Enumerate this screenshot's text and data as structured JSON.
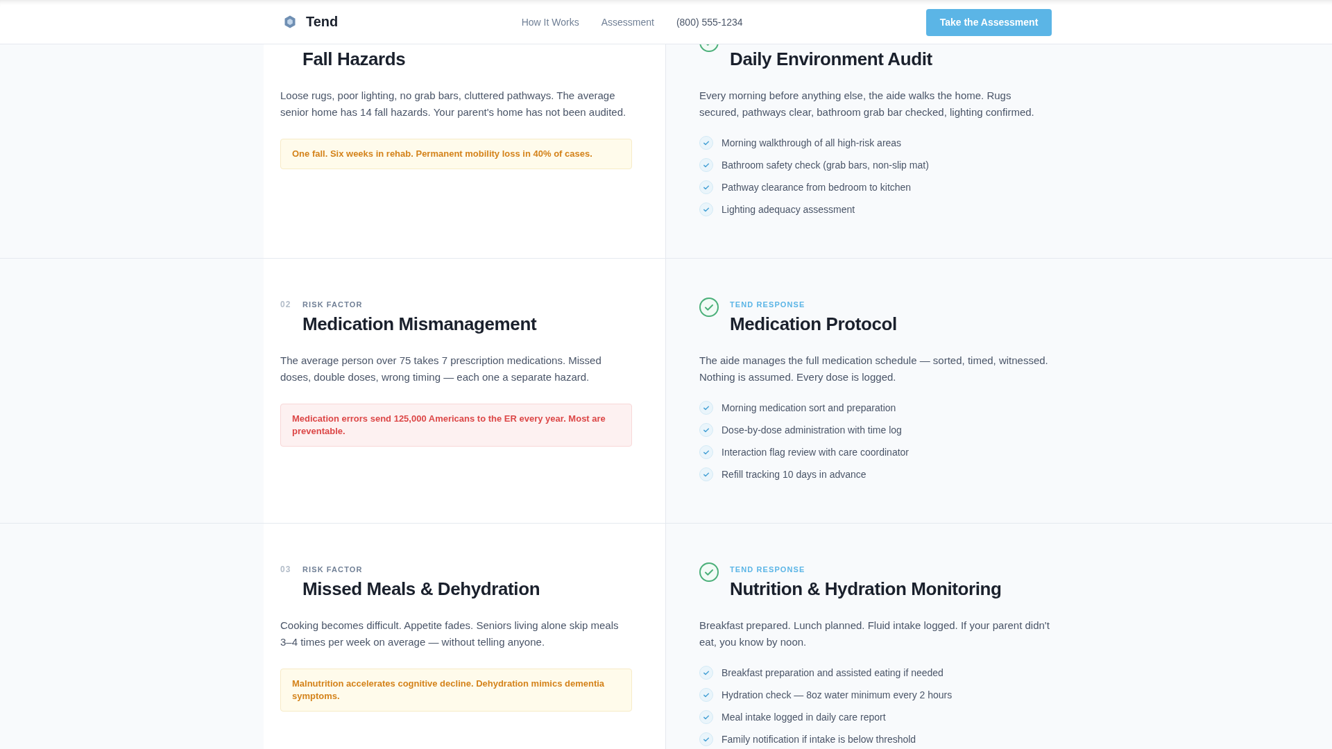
{
  "header": {
    "brand": "Tend",
    "nav": [
      {
        "kind": "link",
        "label": "How It Works"
      },
      {
        "kind": "link",
        "label": "Assessment"
      },
      {
        "kind": "phone",
        "label": "(800) 555-1234"
      }
    ],
    "cta": "Take the Assessment"
  },
  "rows": [
    {
      "risk": {
        "title": "Fall Hazards",
        "text": "Loose rugs, poor lighting, no grab bars, cluttered pathways. The average senior home has 14 fall hazards. Your parent's home has not been audited.",
        "alert": {
          "kind": "warning",
          "text": "One fall. Six weeks in rehab. Permanent mobility loss in 40% of cases."
        }
      },
      "response": {
        "title": "Daily Environment Audit",
        "text": "Every morning before anything else, the aide walks the home. Rugs secured, pathways clear, bathroom grab bar checked, lighting confirmed.",
        "items": [
          "Morning walkthrough of all high-risk areas",
          "Bathroom safety check (grab bars, non-slip mat)",
          "Pathway clearance from bedroom to kitchen",
          "Lighting adequacy assessment"
        ]
      }
    },
    {
      "risk": {
        "number": "02",
        "label": "RISK FACTOR",
        "title": "Medication Mismanagement",
        "text": "The average person over 75 takes 7 prescription medications. Missed doses, double doses, wrong timing — each one a separate hazard.",
        "alert": {
          "kind": "danger",
          "text": "Medication errors send 125,000 Americans to the ER every year. Most are preventable."
        }
      },
      "response": {
        "label": "TEND RESPONSE",
        "title": "Medication Protocol",
        "text": "The aide manages the full medication schedule — sorted, timed, witnessed. Nothing is assumed. Every dose is logged.",
        "items": [
          "Morning medication sort and preparation",
          "Dose-by-dose administration with time log",
          "Interaction flag review with care coordinator",
          "Refill tracking 10 days in advance"
        ]
      }
    },
    {
      "risk": {
        "number": "03",
        "label": "RISK FACTOR",
        "title": "Missed Meals & Dehydration",
        "text": "Cooking becomes difficult. Appetite fades. Seniors living alone skip meals 3–4 times per week on average — without telling anyone.",
        "alert": {
          "kind": "warning",
          "text": "Malnutrition accelerates cognitive decline. Dehydration mimics dementia symptoms."
        }
      },
      "response": {
        "label": "TEND RESPONSE",
        "title": "Nutrition & Hydration Monitoring",
        "text": "Breakfast prepared. Lunch planned. Fluid intake logged. If your parent didn't eat, you know by noon.",
        "items": [
          "Breakfast preparation and assisted eating if needed",
          "Hydration check — 8oz water minimum every 2 hours",
          "Meal intake logged in daily care report",
          "Family notification if intake is below threshold"
        ]
      }
    }
  ]
}
